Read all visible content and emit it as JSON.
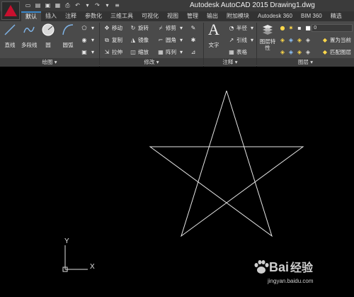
{
  "titlebar": {
    "title": "Autodesk AutoCAD 2015    Drawing1.dwg"
  },
  "tabs": [
    {
      "label": "默认"
    },
    {
      "label": "插入"
    },
    {
      "label": "注释"
    },
    {
      "label": "参数化"
    },
    {
      "label": "三维工具"
    },
    {
      "label": "可视化"
    },
    {
      "label": "视图"
    },
    {
      "label": "管理"
    },
    {
      "label": "输出"
    },
    {
      "label": "附加模块"
    },
    {
      "label": "Autodesk 360"
    },
    {
      "label": "BIM 360"
    },
    {
      "label": "精选"
    }
  ],
  "draw_panel": {
    "line": "直线",
    "polyline": "多段线",
    "circle": "圆",
    "arc": "圆弧",
    "footer": "绘图 ▾"
  },
  "modify_panel": {
    "move": "移动",
    "rotate": "旋转",
    "trim": "修剪",
    "copy": "复制",
    "mirror": "镜像",
    "fillet": "圆角",
    "stretch": "拉伸",
    "scale": "缩放",
    "array": "阵列",
    "footer": "修改 ▾"
  },
  "annotation_panel": {
    "text": "文字",
    "dimension": "标注",
    "radius": "半径",
    "leader": "引线",
    "table": "表格",
    "footer": "注释 ▾"
  },
  "layers_panel": {
    "layer_properties": "图层特性",
    "combo_value": "0",
    "make_current": "置为当前",
    "match_layer": "匹配图层",
    "footer": "图层 ▾"
  },
  "canvas": {
    "ucs_x": "X",
    "ucs_y": "Y"
  },
  "watermark": {
    "brand": "Bai",
    "brand_suffix": "经验",
    "url": "jingyan.baidu.com"
  },
  "colors": {
    "accent_red": "#c8102e",
    "ribbon_bg": "#4a4a4a",
    "canvas_bg": "#000000",
    "geometry": "#e6e6e6"
  }
}
